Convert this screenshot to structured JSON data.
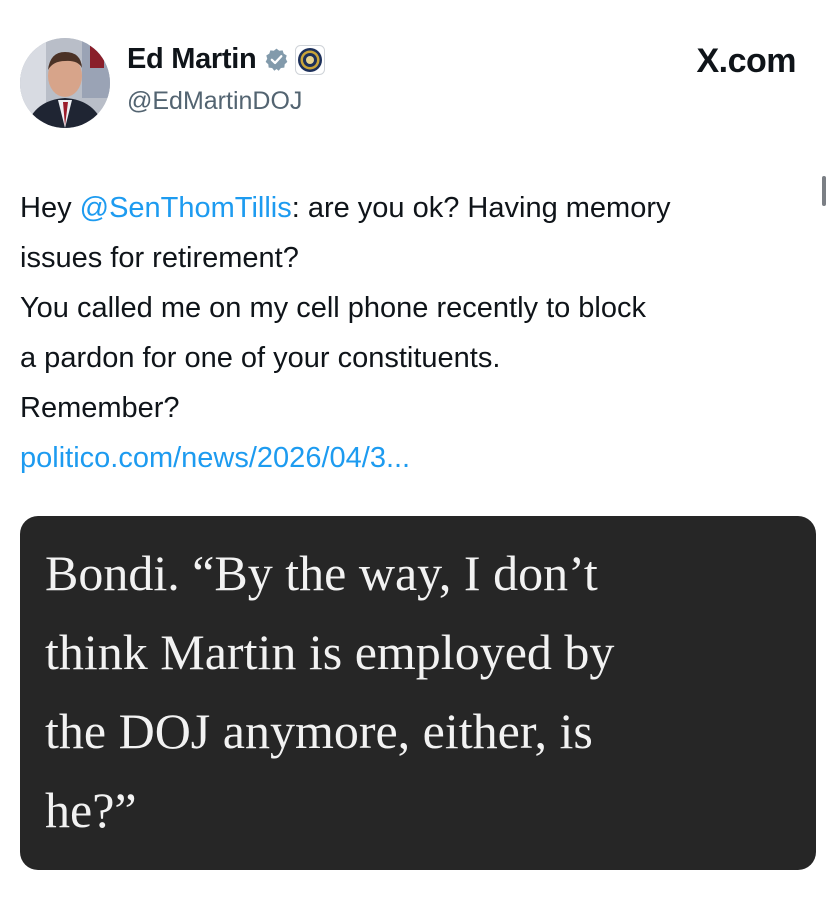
{
  "site_label": "X.com",
  "author": {
    "display_name": "Ed Martin",
    "handle": "@EdMartinDOJ",
    "avatar": "profile-photo",
    "verified_icon": "verified-badge-icon",
    "affiliation_icon": "doj-seal-icon"
  },
  "tweet": {
    "line1_prefix": "Hey ",
    "mention": "@SenThomTillis",
    "line1_suffix": ": are you ok? Having memory",
    "line2": "issues for retirement?",
    "line3": "You called me on my cell phone recently to block",
    "line4": "a pardon for one of your constituents.",
    "line5": "Remember?",
    "link": "politico.com/news/2026/04/3..."
  },
  "media": {
    "quote_lines": [
      "Bondi. “By the way, I don’t",
      "think Martin is employed by",
      "the DOJ anymore, either, is",
      "he?”"
    ]
  },
  "colors": {
    "link": "#1d9bf0",
    "handle": "#536471",
    "media_bg": "#262626",
    "media_text": "#f2f2f2"
  }
}
